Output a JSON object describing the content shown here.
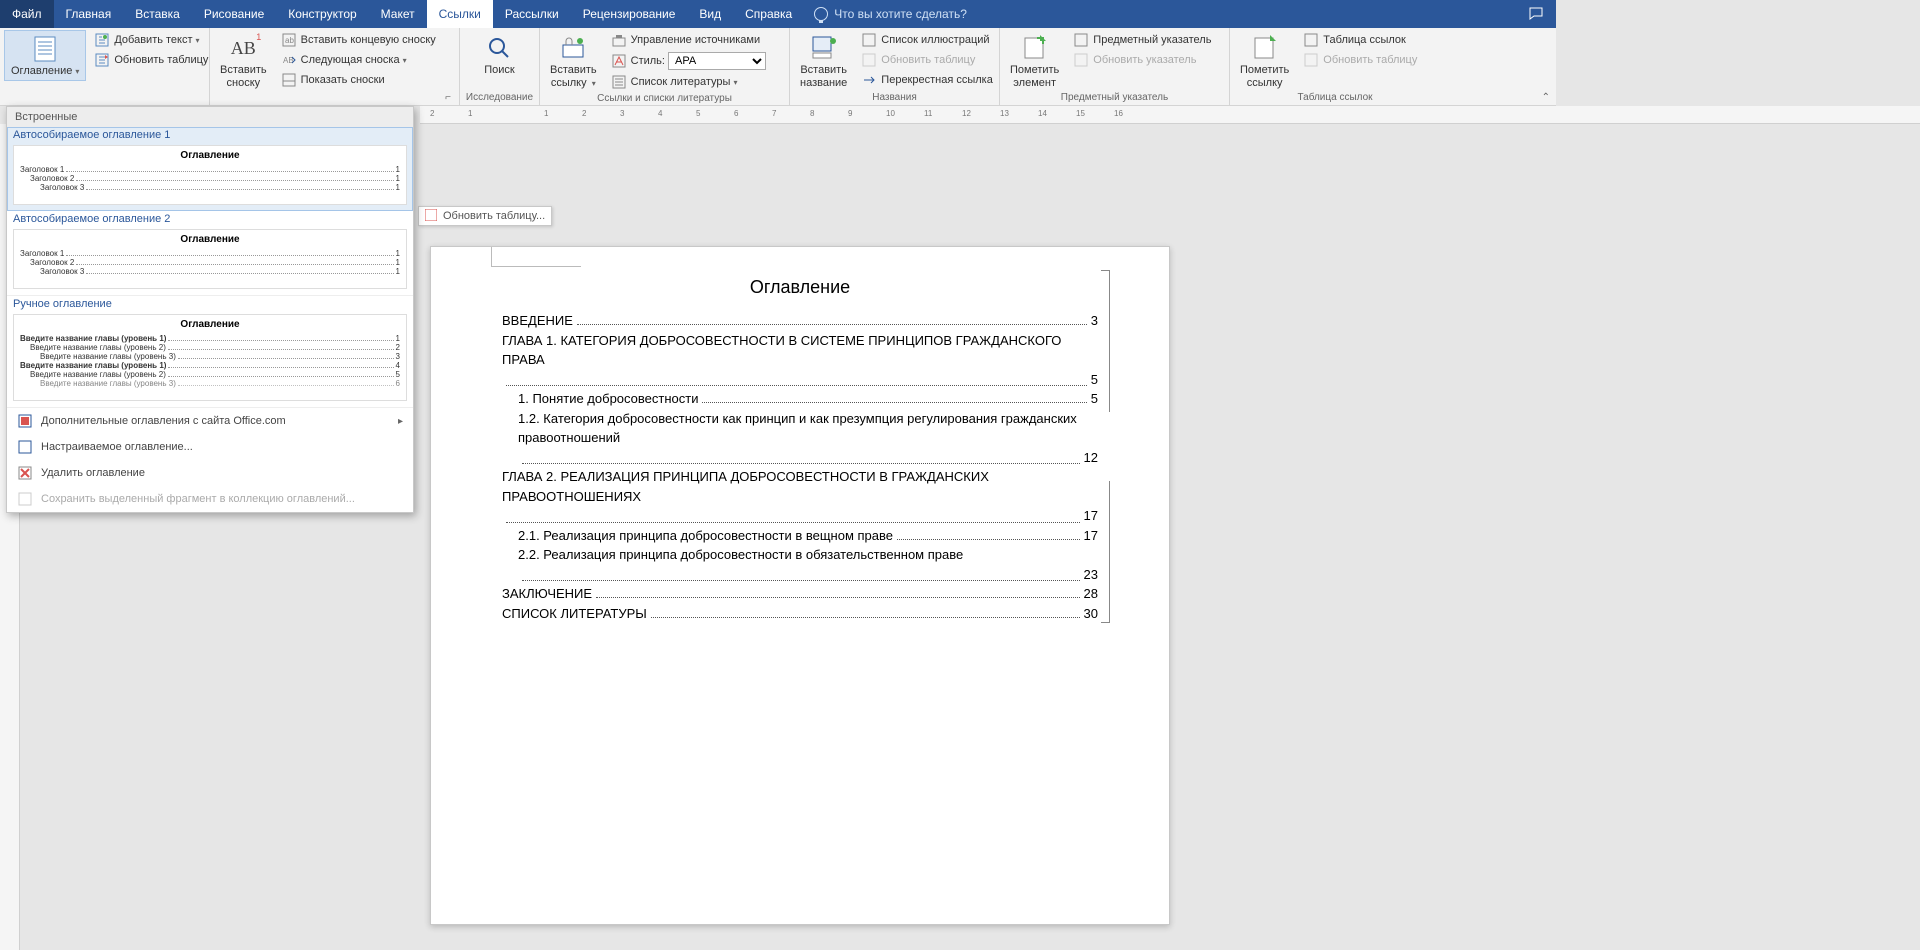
{
  "menubar": {
    "file": "Файл",
    "items": [
      "Главная",
      "Вставка",
      "Рисование",
      "Конструктор",
      "Макет",
      "Ссылки",
      "Рассылки",
      "Рецензирование",
      "Вид",
      "Справка"
    ],
    "active_index": 5,
    "tell_me": "Что вы хотите сделать?"
  },
  "ribbon": {
    "toc": {
      "big": "Оглавление",
      "add_text": "Добавить текст",
      "update": "Обновить таблицу"
    },
    "footnotes": {
      "big": "Вставить\nсноску",
      "endnote": "Вставить концевую сноску",
      "next": "Следующая сноска",
      "show": "Показать сноски"
    },
    "research": {
      "big": "Поиск",
      "label": "Исследование"
    },
    "citations": {
      "insert": "Вставить\nссылку",
      "manage": "Управление источниками",
      "style_label": "Стиль:",
      "style_value": "APA",
      "bibliography": "Список литературы",
      "label": "Ссылки и списки литературы"
    },
    "captions": {
      "insert": "Вставить\nназвание",
      "list_fig": "Список иллюстраций",
      "update": "Обновить таблицу",
      "crossref": "Перекрестная ссылка",
      "label": "Названия"
    },
    "index": {
      "mark": "Пометить\nэлемент",
      "insert": "Предметный указатель",
      "update": "Обновить указатель",
      "label": "Предметный указатель"
    },
    "toa": {
      "mark": "Пометить\nссылку",
      "insert": "Таблица ссылок",
      "update": "Обновить таблицу",
      "label": "Таблица ссылок"
    }
  },
  "gallery": {
    "header": "Встроенные",
    "opt1_title": "Автособираемое оглавление 1",
    "opt2_title": "Автособираемое оглавление 2",
    "opt3_title": "Ручное оглавление",
    "preview_title": "Оглавление",
    "pv_h1": "Заголовок 1",
    "pv_h2": "Заголовок 2",
    "pv_h3": "Заголовок 3",
    "pv_m1": "Введите название главы (уровень 1)",
    "pv_m2": "Введите название главы (уровень 2)",
    "pv_m3": "Введите название главы (уровень 3)",
    "pv_p1": "1",
    "pv_p2": "2",
    "pv_p3": "3",
    "pv_p4": "4",
    "pv_p5": "5",
    "pv_p6": "6",
    "more": "Дополнительные оглавления с сайта Office.com",
    "custom": "Настраиваемое оглавление...",
    "remove": "Удалить оглавление",
    "save": "Сохранить выделенный фрагмент в коллекцию оглавлений..."
  },
  "doc": {
    "update_btn": "Обновить таблицу...",
    "toc_title": "Оглавление",
    "rows": [
      {
        "text": "ВВЕДЕНИЕ",
        "page": "3",
        "ind": 0
      },
      {
        "text": "ГЛАВА 1. КАТЕГОРИЯ ДОБРОСОВЕСТНОСТИ В СИСТЕМЕ ПРИНЦИПОВ ГРАЖДАНСКОГО ПРАВА",
        "page": "5",
        "ind": 0
      },
      {
        "text": "1. Понятие добросовестности",
        "page": "5",
        "ind": 1
      },
      {
        "text": "1.2. Категория добросовестности как принцип и как презумпция регулирования гражданских правоотношений",
        "page": "12",
        "ind": 1
      },
      {
        "text": "ГЛАВА 2. РЕАЛИЗАЦИЯ ПРИНЦИПА ДОБРОСОВЕСТНОСТИ В ГРАЖДАНСКИХ ПРАВООТНОШЕНИЯХ",
        "page": "17",
        "ind": 0
      },
      {
        "text": "2.1. Реализация принципа добросовестности в вещном праве",
        "page": "17",
        "ind": 1
      },
      {
        "text": "2.2. Реализация принципа добросовестности в обязательственном праве",
        "page": "23",
        "ind": 1
      },
      {
        "text": "ЗАКЛЮЧЕНИЕ",
        "page": "28",
        "ind": 0
      },
      {
        "text": "СПИСОК ЛИТЕРАТУРЫ",
        "page": "30",
        "ind": 0
      }
    ]
  },
  "ruler_numbers": [
    "2",
    "1",
    "",
    "1",
    "2",
    "3",
    "4",
    "5",
    "6",
    "7",
    "8",
    "9",
    "10",
    "11",
    "12",
    "13",
    "14",
    "15",
    "16"
  ]
}
